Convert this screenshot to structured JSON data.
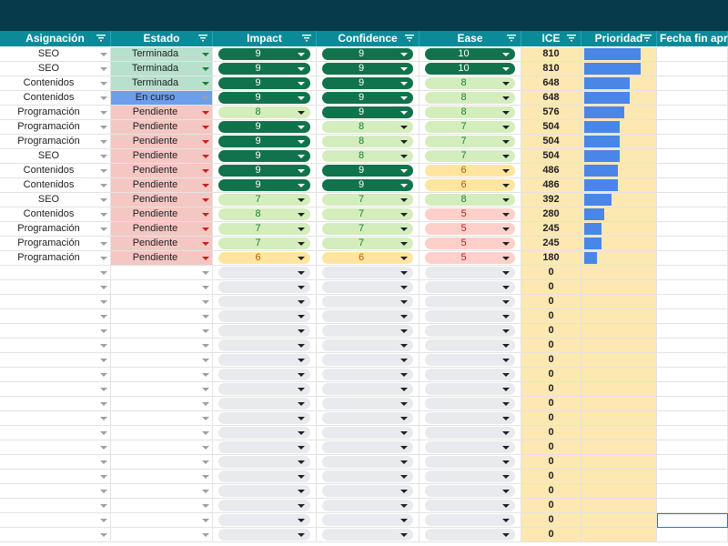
{
  "columns": [
    {
      "label": "Asignación"
    },
    {
      "label": "Estado"
    },
    {
      "label": "Impact"
    },
    {
      "label": "Confidence"
    },
    {
      "label": "Ease"
    },
    {
      "label": "ICE"
    },
    {
      "label": "Prioridad"
    },
    {
      "label": "Fecha fin apro"
    }
  ],
  "colors": {
    "topbar": "#073b4c",
    "header": "#0b8a9a",
    "status_Terminada": "#b7e1cd",
    "status_En curso": "#6d9eeb",
    "status_Pendiente": "#f4c7c3",
    "score_dark": "#11734b",
    "score_light": "#d4edbc",
    "score_yellow": "#ffe5a0",
    "score_orange": "#ffcfc9",
    "score_empty": "#e8eaed",
    "ice_bg": "#fde8b2",
    "bar": "#4a86e8"
  },
  "rows": [
    {
      "asignacion": "SEO",
      "estado": "Terminada",
      "impact": "9",
      "confidence": "9",
      "ease": "10",
      "ice": "810",
      "prioridad": 0.81
    },
    {
      "asignacion": "SEO",
      "estado": "Terminada",
      "impact": "9",
      "confidence": "9",
      "ease": "10",
      "ice": "810",
      "prioridad": 0.81
    },
    {
      "asignacion": "Contenidos",
      "estado": "Terminada",
      "impact": "9",
      "confidence": "9",
      "ease": "8",
      "ice": "648",
      "prioridad": 0.648
    },
    {
      "asignacion": "Contenidos",
      "estado": "En curso",
      "impact": "9",
      "confidence": "9",
      "ease": "8",
      "ice": "648",
      "prioridad": 0.648
    },
    {
      "asignacion": "Programación",
      "estado": "Pendiente",
      "impact": "8",
      "confidence": "9",
      "ease": "8",
      "ice": "576",
      "prioridad": 0.576
    },
    {
      "asignacion": "Programación",
      "estado": "Pendiente",
      "impact": "9",
      "confidence": "8",
      "ease": "7",
      "ice": "504",
      "prioridad": 0.504
    },
    {
      "asignacion": "Programación",
      "estado": "Pendiente",
      "impact": "9",
      "confidence": "8",
      "ease": "7",
      "ice": "504",
      "prioridad": 0.504
    },
    {
      "asignacion": "SEO",
      "estado": "Pendiente",
      "impact": "9",
      "confidence": "8",
      "ease": "7",
      "ice": "504",
      "prioridad": 0.504
    },
    {
      "asignacion": "Contenidos",
      "estado": "Pendiente",
      "impact": "9",
      "confidence": "9",
      "ease": "6",
      "ice": "486",
      "prioridad": 0.486
    },
    {
      "asignacion": "Contenidos",
      "estado": "Pendiente",
      "impact": "9",
      "confidence": "9",
      "ease": "6",
      "ice": "486",
      "prioridad": 0.486
    },
    {
      "asignacion": "SEO",
      "estado": "Pendiente",
      "impact": "7",
      "confidence": "7",
      "ease": "8",
      "ice": "392",
      "prioridad": 0.392
    },
    {
      "asignacion": "Contenidos",
      "estado": "Pendiente",
      "impact": "8",
      "confidence": "7",
      "ease": "5",
      "ice": "280",
      "prioridad": 0.28
    },
    {
      "asignacion": "Programación",
      "estado": "Pendiente",
      "impact": "7",
      "confidence": "7",
      "ease": "5",
      "ice": "245",
      "prioridad": 0.245
    },
    {
      "asignacion": "Programación",
      "estado": "Pendiente",
      "impact": "7",
      "confidence": "7",
      "ease": "5",
      "ice": "245",
      "prioridad": 0.245
    },
    {
      "asignacion": "Programación",
      "estado": "Pendiente",
      "impact": "6",
      "confidence": "6",
      "ease": "5",
      "ice": "180",
      "prioridad": 0.18
    },
    {
      "asignacion": "",
      "estado": "",
      "impact": "",
      "confidence": "",
      "ease": "",
      "ice": "0",
      "prioridad": 0
    },
    {
      "asignacion": "",
      "estado": "",
      "impact": "",
      "confidence": "",
      "ease": "",
      "ice": "0",
      "prioridad": 0
    },
    {
      "asignacion": "",
      "estado": "",
      "impact": "",
      "confidence": "",
      "ease": "",
      "ice": "0",
      "prioridad": 0
    },
    {
      "asignacion": "",
      "estado": "",
      "impact": "",
      "confidence": "",
      "ease": "",
      "ice": "0",
      "prioridad": 0
    },
    {
      "asignacion": "",
      "estado": "",
      "impact": "",
      "confidence": "",
      "ease": "",
      "ice": "0",
      "prioridad": 0
    },
    {
      "asignacion": "",
      "estado": "",
      "impact": "",
      "confidence": "",
      "ease": "",
      "ice": "0",
      "prioridad": 0
    },
    {
      "asignacion": "",
      "estado": "",
      "impact": "",
      "confidence": "",
      "ease": "",
      "ice": "0",
      "prioridad": 0
    },
    {
      "asignacion": "",
      "estado": "",
      "impact": "",
      "confidence": "",
      "ease": "",
      "ice": "0",
      "prioridad": 0
    },
    {
      "asignacion": "",
      "estado": "",
      "impact": "",
      "confidence": "",
      "ease": "",
      "ice": "0",
      "prioridad": 0
    },
    {
      "asignacion": "",
      "estado": "",
      "impact": "",
      "confidence": "",
      "ease": "",
      "ice": "0",
      "prioridad": 0
    },
    {
      "asignacion": "",
      "estado": "",
      "impact": "",
      "confidence": "",
      "ease": "",
      "ice": "0",
      "prioridad": 0
    },
    {
      "asignacion": "",
      "estado": "",
      "impact": "",
      "confidence": "",
      "ease": "",
      "ice": "0",
      "prioridad": 0
    },
    {
      "asignacion": "",
      "estado": "",
      "impact": "",
      "confidence": "",
      "ease": "",
      "ice": "0",
      "prioridad": 0
    },
    {
      "asignacion": "",
      "estado": "",
      "impact": "",
      "confidence": "",
      "ease": "",
      "ice": "0",
      "prioridad": 0
    },
    {
      "asignacion": "",
      "estado": "",
      "impact": "",
      "confidence": "",
      "ease": "",
      "ice": "0",
      "prioridad": 0
    },
    {
      "asignacion": "",
      "estado": "",
      "impact": "",
      "confidence": "",
      "ease": "",
      "ice": "0",
      "prioridad": 0
    },
    {
      "asignacion": "",
      "estado": "",
      "impact": "",
      "confidence": "",
      "ease": "",
      "ice": "0",
      "prioridad": 0
    },
    {
      "asignacion": "",
      "estado": "",
      "impact": "",
      "confidence": "",
      "ease": "",
      "ice": "0",
      "prioridad": 0
    },
    {
      "asignacion": "",
      "estado": "",
      "impact": "",
      "confidence": "",
      "ease": "",
      "ice": "0",
      "prioridad": 0
    }
  ]
}
